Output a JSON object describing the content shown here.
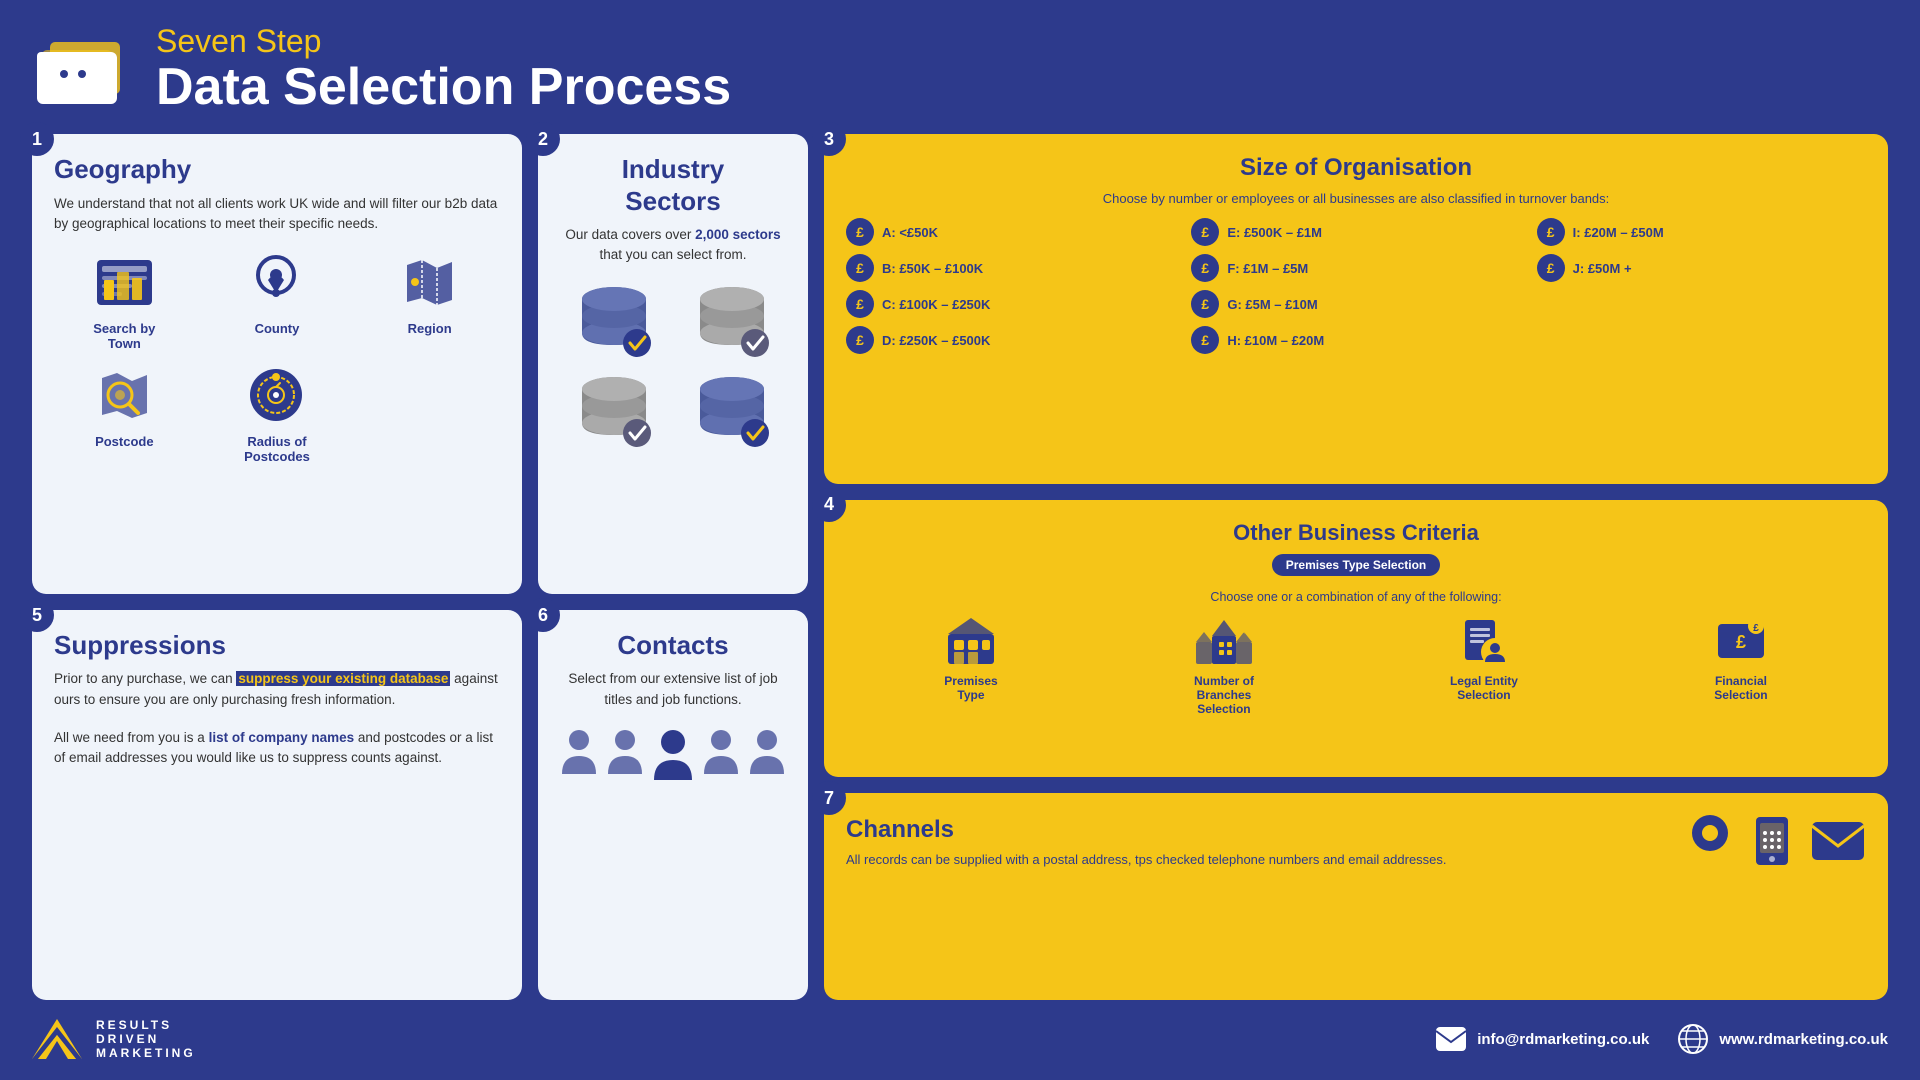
{
  "header": {
    "subtitle": "Seven Step",
    "title": "Data Selection Process"
  },
  "steps": {
    "step1": {
      "number": "1",
      "title": "Geography",
      "description": "We understand that not all clients work UK wide and will filter our b2b data by geographical locations to meet their specific needs.",
      "icons": [
        {
          "id": "search-by-town",
          "label": "Search by\nTown"
        },
        {
          "id": "county",
          "label": "County"
        },
        {
          "id": "region",
          "label": "Region"
        },
        {
          "id": "postcode",
          "label": "Postcode"
        },
        {
          "id": "radius-of-postcodes",
          "label": "Radius of\nPostcodes"
        }
      ]
    },
    "step2": {
      "number": "2",
      "title": "Industry\nSectors",
      "description": "Our data covers over ",
      "highlight": "2,000 sectors",
      "description2": " that you can select from."
    },
    "step3": {
      "number": "3",
      "title": "Size of Organisation",
      "subtitle": "Choose by number or employees or all businesses are also classified in turnover bands:",
      "bands": [
        {
          "label": "A: <£50K"
        },
        {
          "label": "B: £50K – £100K"
        },
        {
          "label": "C: £100K – £250K"
        },
        {
          "label": "D: £250K – £500K"
        },
        {
          "label": "E: £500K – £1M"
        },
        {
          "label": "F: £1M – £5M"
        },
        {
          "label": "G: £5M – £10M"
        },
        {
          "label": "H: £10M – £20M"
        },
        {
          "label": "I: £20M – £50M"
        },
        {
          "label": "J: £50M +"
        }
      ]
    },
    "step4": {
      "number": "4",
      "title": "Other Business Criteria",
      "badge": "Premises Type Selection",
      "subtitle": "Choose one or a combination of any of the following:",
      "criteria": [
        {
          "id": "premises-type",
          "label": "Premises\nType"
        },
        {
          "id": "number-of-branches",
          "label": "Number of\nBranches\nSelection"
        },
        {
          "id": "legal-entity",
          "label": "Legal Entity\nSelection"
        },
        {
          "id": "financial-selection",
          "label": "Financial\nSelection"
        }
      ]
    },
    "step5": {
      "number": "5",
      "title": "Suppressions",
      "text1": "Prior to any purchase, we can ",
      "highlight1": "suppress your existing database",
      "text2": " against ours to ensure you are only purchasing fresh information.",
      "text3": "All we need from you is a ",
      "highlight2": "list of company names",
      "text4": " and postcodes or a list of email addresses you would like us to suppress counts against."
    },
    "step6": {
      "number": "6",
      "title": "Contacts",
      "description": "Select from our extensive list of job titles and job functions."
    },
    "step7": {
      "number": "7",
      "title": "Channels",
      "description": "All records can be supplied with a postal address, tps checked telephone numbers and email addresses."
    }
  },
  "footer": {
    "logo_lines": [
      "RESULTS",
      "DRIVEN",
      "MARKETING"
    ],
    "email": "info@rdmarketing.co.uk",
    "website": "www.rdmarketing.co.uk"
  }
}
